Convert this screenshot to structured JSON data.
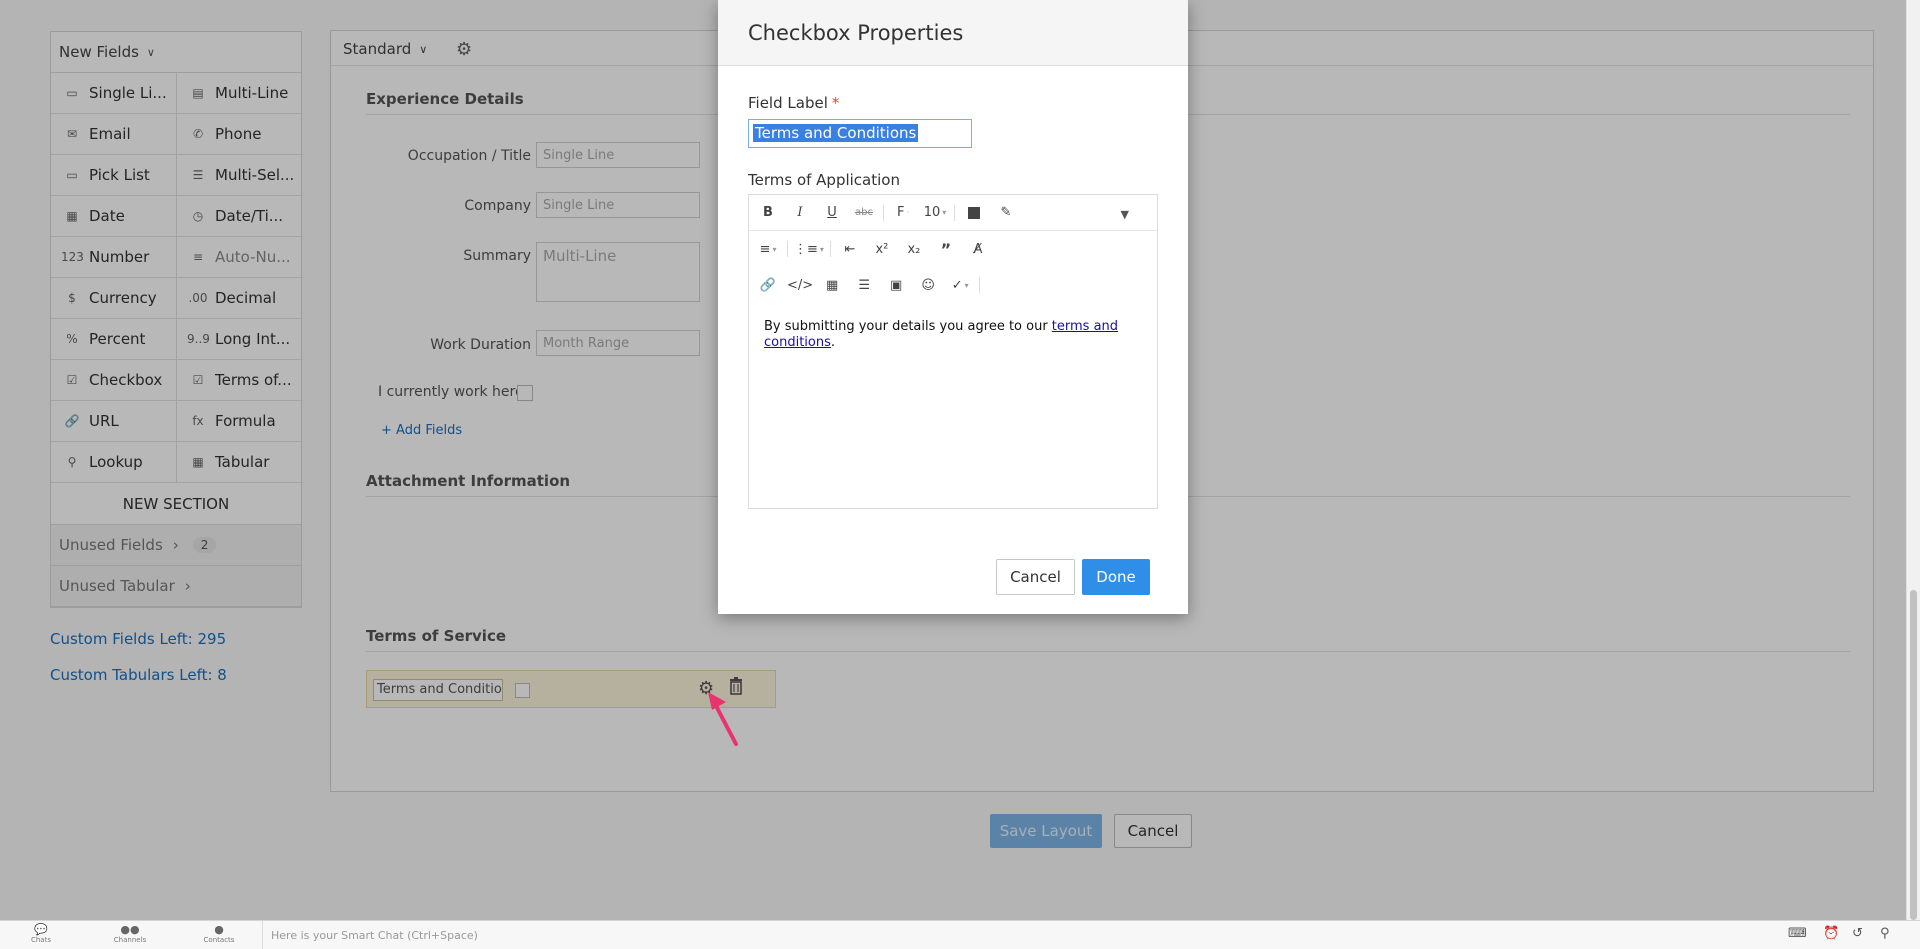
{
  "palette": {
    "header": "New Fields",
    "items": [
      {
        "label": "Single Li...",
        "icon": "single-line-icon"
      },
      {
        "label": "Multi-Line",
        "icon": "multi-line-icon"
      },
      {
        "label": "Email",
        "icon": "email-icon"
      },
      {
        "label": "Phone",
        "icon": "phone-icon"
      },
      {
        "label": "Pick List",
        "icon": "pick-list-icon"
      },
      {
        "label": "Multi-Sel...",
        "icon": "multi-select-icon"
      },
      {
        "label": "Date",
        "icon": "date-icon"
      },
      {
        "label": "Date/Ti...",
        "icon": "date-time-icon"
      },
      {
        "label": "Number",
        "icon": "number-icon",
        "glyph": "123"
      },
      {
        "label": "Auto-Nu...",
        "icon": "auto-number-icon"
      },
      {
        "label": "Currency",
        "icon": "currency-icon",
        "glyph": "$"
      },
      {
        "label": "Decimal",
        "icon": "decimal-icon",
        "glyph": ".00"
      },
      {
        "label": "Percent",
        "icon": "percent-icon",
        "glyph": "%"
      },
      {
        "label": "Long Int...",
        "icon": "long-integer-icon",
        "glyph": "9..9"
      },
      {
        "label": "Checkbox",
        "icon": "checkbox-icon"
      },
      {
        "label": "Terms of...",
        "icon": "terms-icon"
      },
      {
        "label": "URL",
        "icon": "url-icon"
      },
      {
        "label": "Formula",
        "icon": "formula-icon",
        "glyph": "fx"
      },
      {
        "label": "Lookup",
        "icon": "lookup-icon"
      },
      {
        "label": "Tabular",
        "icon": "tabular-icon"
      }
    ],
    "new_section": "NEW SECTION",
    "unused_fields": "Unused Fields",
    "unused_fields_count": "2",
    "unused_tabular": "Unused Tabular",
    "custom_fields_left": "Custom Fields Left: 295",
    "custom_tabulars_left": "Custom Tabulars Left: 8"
  },
  "layout": {
    "selector": "Standard",
    "sections": {
      "experience": "Experience Details",
      "attachment": "Attachment Information",
      "terms": "Terms of Service"
    },
    "fields": [
      {
        "label": "Occupation / Title",
        "placeholder": "Single Line"
      },
      {
        "label": "Company",
        "placeholder": "Single Line"
      },
      {
        "label": "Summary",
        "placeholder": "Multi-Line"
      },
      {
        "label": "Work Duration",
        "placeholder": "Month Range"
      }
    ],
    "checkbox_label": "I currently work here",
    "add_fields": "Add Fields",
    "terms_field_value": "Terms and Conditions",
    "save_layout": "Save Layout",
    "cancel": "Cancel"
  },
  "modal": {
    "title": "Checkbox Properties",
    "field_label": "Field Label",
    "required_mark": "*",
    "field_label_value": "Terms and Conditions",
    "terms_label": "Terms of Application",
    "font_size": "10",
    "content_text": "By submitting your details you agree to our ",
    "content_link": "terms and conditions",
    "content_end": ".",
    "cancel": "Cancel",
    "done": "Done"
  },
  "bottom_bar": {
    "chats": "Chats",
    "channels": "Channels",
    "contacts": "Contacts",
    "smart_chat_placeholder": "Here is your Smart Chat (Ctrl+Space)"
  },
  "colors": {
    "accent": "#2f8fe8",
    "link": "#1a6fc0",
    "required": "#e0452d",
    "arrow": "#e8336e"
  }
}
